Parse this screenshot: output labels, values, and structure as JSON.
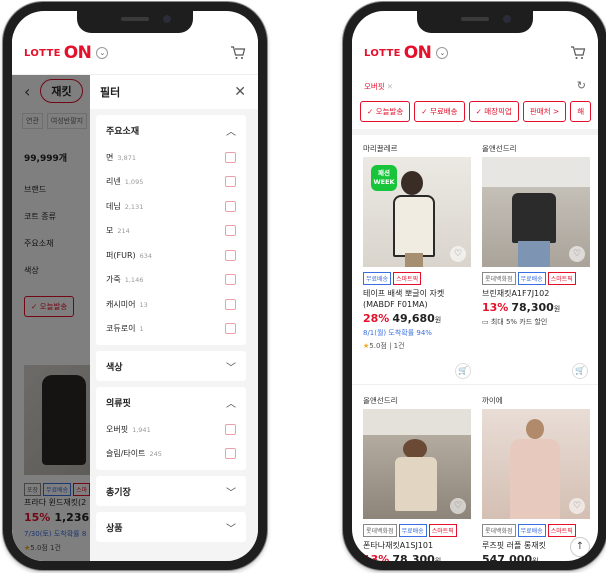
{
  "header": {
    "logo_prefix": "LOTTE",
    "logo_main": "ON"
  },
  "left": {
    "category_pill": "재킷",
    "chips": [
      "연관",
      "여성반팔지"
    ],
    "count": "99,999개",
    "filter_options": [
      "브랜드",
      "코트 종류",
      "주요소재",
      "색상"
    ],
    "pill": "✓ 오늘발송",
    "product": {
      "tags": [
        "포장",
        "무료배송",
        "스마"
      ],
      "name": "프라다 윈드재킷(2",
      "pct": "15%",
      "price": "1,236,4",
      "delivery": "7/30(토) 도착확률 8",
      "rating": "5.0점 1건"
    },
    "panel": {
      "title": "필터",
      "sections": [
        {
          "title": "주요소재",
          "expanded": true,
          "options": [
            {
              "label": "면",
              "count": "3,871"
            },
            {
              "label": "리넨",
              "count": "1,095"
            },
            {
              "label": "데님",
              "count": "2,131"
            },
            {
              "label": "모",
              "count": "214"
            },
            {
              "label": "퍼(FUR)",
              "count": "634"
            },
            {
              "label": "가죽",
              "count": "1,146"
            },
            {
              "label": "캐시미어",
              "count": "13"
            },
            {
              "label": "코듀로이",
              "count": "1"
            }
          ]
        },
        {
          "title": "색상",
          "expanded": false
        },
        {
          "title": "의류핏",
          "expanded": true,
          "options": [
            {
              "label": "오버핏",
              "count": "1,941"
            },
            {
              "label": "슬림/타이트",
              "count": "245"
            }
          ]
        },
        {
          "title": "총기장",
          "expanded": false
        },
        {
          "title": "상품",
          "expanded": false
        }
      ]
    }
  },
  "right": {
    "active_tag": "오버핏",
    "pills": [
      "✓ 오늘발송",
      "✓ 무료배송",
      "✓ 매장픽업",
      "판매처 >",
      "해"
    ],
    "products": [
      {
        "brand": "마리끌레르",
        "badge": "패션\nWEEK",
        "tags": [
          "무료배송",
          "스마트픽"
        ],
        "name": "테이프 배색 뽀글이 자켓 (MABDF F01MA)",
        "pct": "28%",
        "price": "49,680",
        "won": "원",
        "delivery": "8/1(월) 도착확률 94%",
        "rating": "5.0점",
        "reviews": "1건"
      },
      {
        "brand": "올앤선드리",
        "tags": [
          "롯데백화점",
          "무료배송",
          "스마트픽"
        ],
        "name": "브린재킷A1F7J102",
        "pct": "13%",
        "price": "78,300",
        "won": "원",
        "card": "최대 5% 카드 할인"
      },
      {
        "brand": "올앤선드리",
        "tags": [
          "롯데백화점",
          "무료배송",
          "스마트픽"
        ],
        "name": "폰타나재킷A1SJ101",
        "pct": "13%",
        "price": "78,300",
        "won": "원"
      },
      {
        "brand": "까이에",
        "tags": [
          "롯데백화점",
          "무료배송",
          "스마트픽"
        ],
        "name": "루즈핏 러플 롱재킷",
        "pct": "",
        "price": "547,000",
        "won": "원"
      }
    ]
  },
  "colors": {
    "brand": "#e5102b",
    "link": "#3a6ee0"
  }
}
